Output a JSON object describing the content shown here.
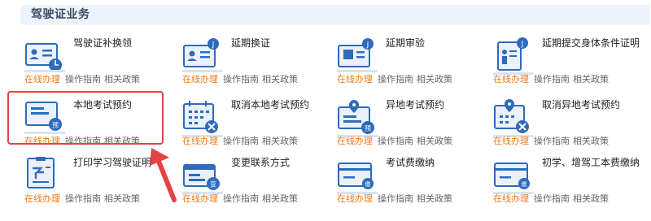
{
  "header": {
    "title": "驾驶证业务"
  },
  "link_labels": {
    "primary": "在线办理",
    "guide": "操作指南",
    "policy": "相关政策"
  },
  "services": [
    {
      "id": "s1",
      "title": "驾驶证补换领",
      "icon": "license-replace-icon"
    },
    {
      "id": "s2",
      "title": "延期换证",
      "icon": "license-extend-icon"
    },
    {
      "id": "s3",
      "title": "延期审验",
      "icon": "review-extend-icon"
    },
    {
      "id": "s4",
      "title": "延期提交身体条件证明",
      "icon": "health-proof-icon"
    },
    {
      "id": "s5",
      "title": "本地考试预约",
      "icon": "local-exam-booking-icon"
    },
    {
      "id": "s6",
      "title": "取消本地考试预约",
      "icon": "cancel-calendar-icon"
    },
    {
      "id": "s7",
      "title": "异地考试预约",
      "icon": "remote-exam-booking-icon"
    },
    {
      "id": "s8",
      "title": "取消异地考试预约",
      "icon": "cancel-remote-calendar-icon"
    },
    {
      "id": "s9",
      "title": "打印学习驾驶证明",
      "icon": "print-certificate-icon"
    },
    {
      "id": "s10",
      "title": "变更联系方式",
      "icon": "contact-change-icon"
    },
    {
      "id": "s11",
      "title": "考试费缴纳",
      "icon": "exam-fee-card-icon"
    },
    {
      "id": "s12",
      "title": "初学、增驾工本费缴纳",
      "icon": "fee-card-icon"
    }
  ],
  "colors": {
    "accent": "#f07a18",
    "icon_blue": "#2e6bbd",
    "highlight": "#e24444",
    "header_bg": "#eef3fb"
  }
}
